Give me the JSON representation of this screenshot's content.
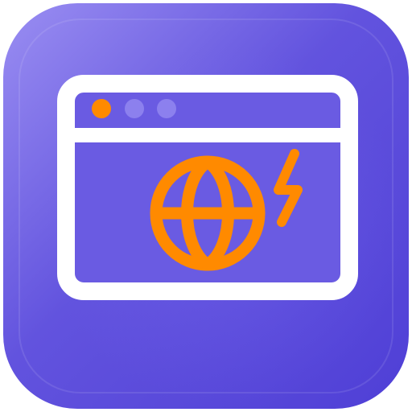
{
  "icon": {
    "name": "web-browser-globe-lightning-app-icon",
    "glyphs": [
      "browser-window-icon",
      "globe-icon",
      "lightning-bolt-icon"
    ]
  },
  "colors": {
    "background_top_left": "#9A8EF2",
    "background_mid": "#6253DE",
    "background_bottom_right": "#4F3FD6",
    "window_fill": "#6A5BE2",
    "window_outline": "#FFFFFF",
    "accent_orange": "#FF8A00",
    "tab_dot_inactive": "#8C80EE"
  },
  "window": {
    "traffic_lights": [
      "active",
      "inactive",
      "inactive"
    ]
  }
}
